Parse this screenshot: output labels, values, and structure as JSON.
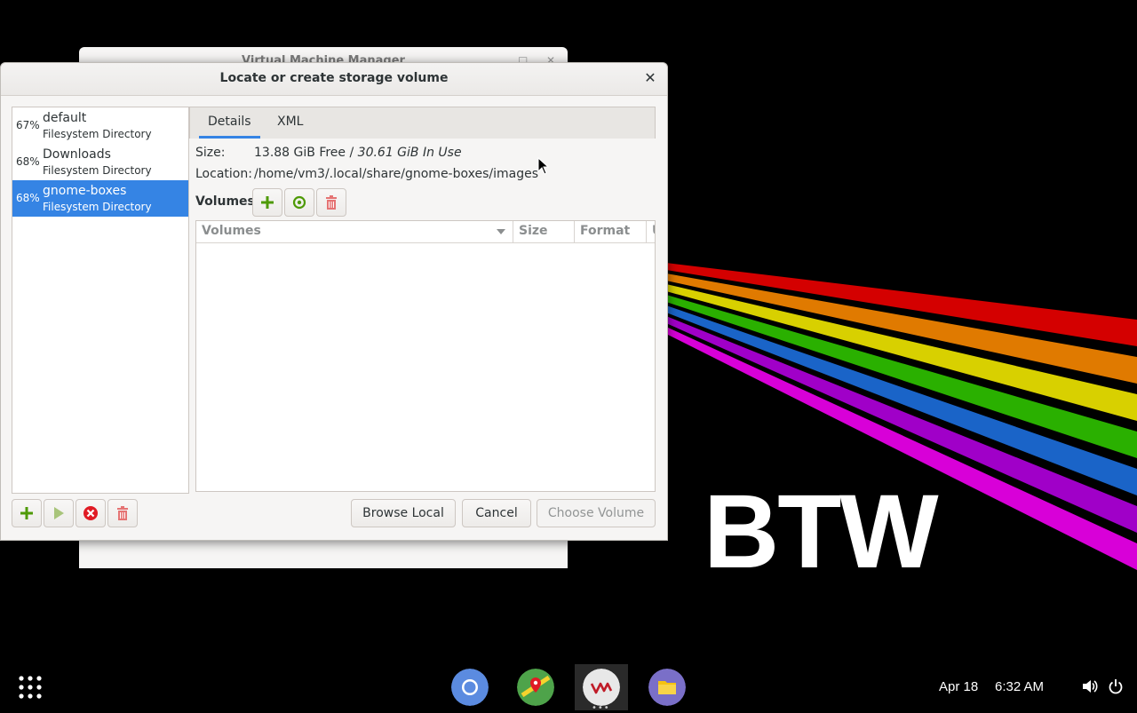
{
  "wallpaper": {
    "text": "BTW",
    "stripe_colors": [
      "#d40000",
      "#e07a00",
      "#d8d000",
      "#2ab000",
      "#1a64c8",
      "#a000c8",
      "#d800d8"
    ]
  },
  "back_window": {
    "title": "Virtual Machine Manager"
  },
  "dialog": {
    "title": "Locate or create storage volume",
    "close_icon": "close-icon",
    "pools": [
      {
        "percent": "67%",
        "name": "default",
        "type": "Filesystem Directory",
        "selected": false
      },
      {
        "percent": "68%",
        "name": "Downloads",
        "type": "Filesystem Directory",
        "selected": false
      },
      {
        "percent": "68%",
        "name": "gnome-boxes",
        "type": "Filesystem Directory",
        "selected": true
      }
    ],
    "tabs": [
      {
        "label": "Details",
        "active": true
      },
      {
        "label": "XML",
        "active": false
      }
    ],
    "details": {
      "size_label": "Size:",
      "size_free": "13.88 GiB Free / ",
      "size_in_use": "30.61 GiB In Use",
      "location_label": "Location:",
      "location_value": "/home/vm3/.local/share/gnome-boxes/images",
      "volumes_label": "Volumes"
    },
    "volume_table": {
      "columns": [
        "Volumes",
        "Size",
        "Format",
        "U"
      ],
      "rows": []
    },
    "buttons": {
      "browse_local": "Browse Local",
      "cancel": "Cancel",
      "choose_volume": "Choose Volume"
    },
    "colors": {
      "accent": "#3584e4",
      "add": "#4e9a06",
      "refresh": "#4e9a06",
      "delete": "#e57373",
      "stop": "#e01b24"
    }
  },
  "taskbar": {
    "date": "Apr 18",
    "time": "6:32 AM",
    "dock": [
      "chromium-icon",
      "maps-icon",
      "virt-manager-icon",
      "files-icon"
    ],
    "tray": [
      "volume-icon",
      "power-icon"
    ]
  }
}
